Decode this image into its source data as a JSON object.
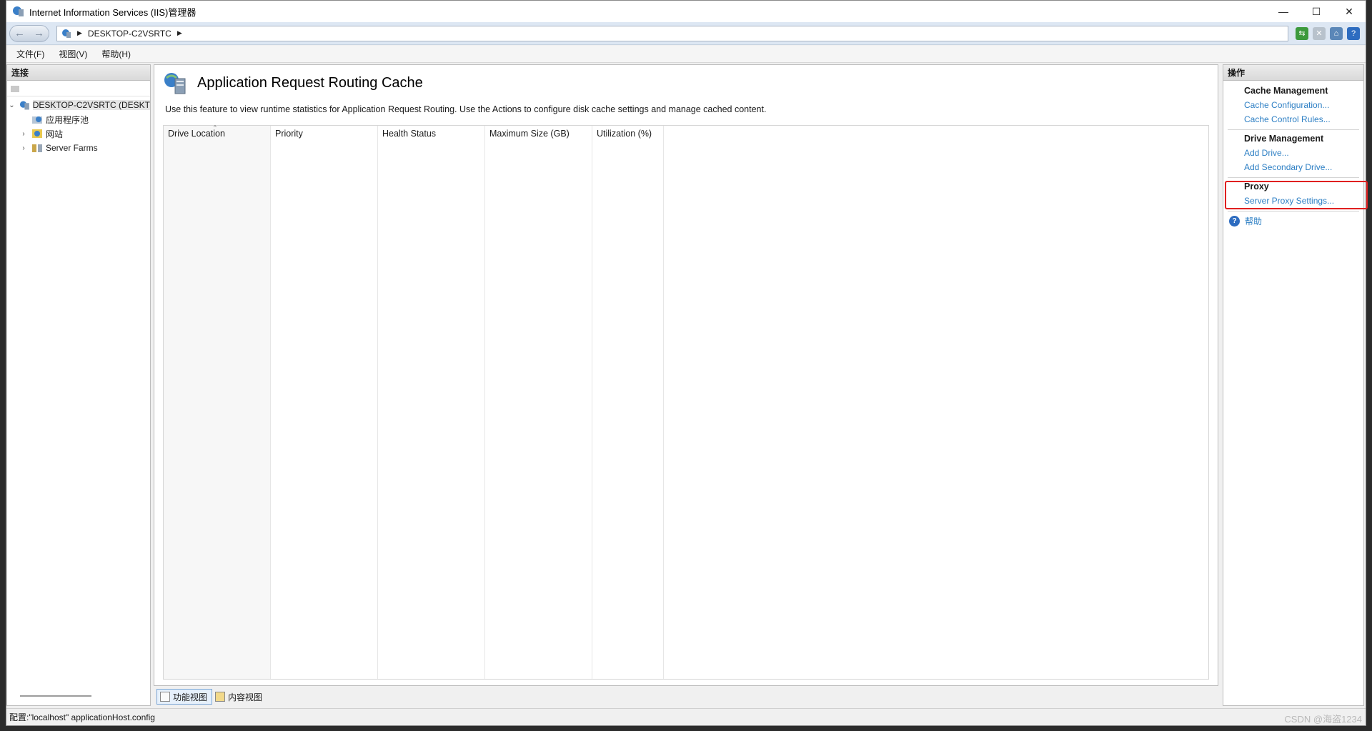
{
  "window": {
    "title": "Internet Information Services (IIS)管理器"
  },
  "address": {
    "path": "DESKTOP-C2VSRTC"
  },
  "menu": [
    "文件(F)",
    "视图(V)",
    "帮助(H)"
  ],
  "left": {
    "header": "连接",
    "tree": [
      {
        "label": "DESKTOP-C2VSRTC (DESKT",
        "expander": "⌄"
      },
      {
        "label": "应用程序池",
        "expander": ""
      },
      {
        "label": "网站",
        "expander": "›"
      },
      {
        "label": "Server Farms",
        "expander": "›"
      }
    ]
  },
  "main": {
    "title": "Application Request Routing Cache",
    "description": "Use this feature to view runtime statistics for Application Request Routing.  Use the Actions to configure disk cache settings and manage cached content.",
    "columns": [
      "Drive Location",
      "Priority",
      "Health Status",
      "Maximum Size (GB)",
      "Utilization (%)"
    ],
    "tabs": [
      "功能视图",
      "内容视图"
    ]
  },
  "right": {
    "header": "操作",
    "groups": [
      {
        "title": "Cache Management",
        "links": [
          "Cache Configuration...",
          "Cache Control Rules..."
        ]
      },
      {
        "title": "Drive Management",
        "links": [
          "Add Drive...",
          "Add Secondary Drive..."
        ]
      },
      {
        "title": "Proxy",
        "links": [
          "Server Proxy Settings..."
        ]
      }
    ],
    "help": "帮助"
  },
  "status": {
    "text": "配置:\"localhost\" applicationHost.config"
  },
  "watermark": "CSDN @海盗1234",
  "colors": {
    "link": "#2d7fc4",
    "highlight": "#e02020"
  }
}
